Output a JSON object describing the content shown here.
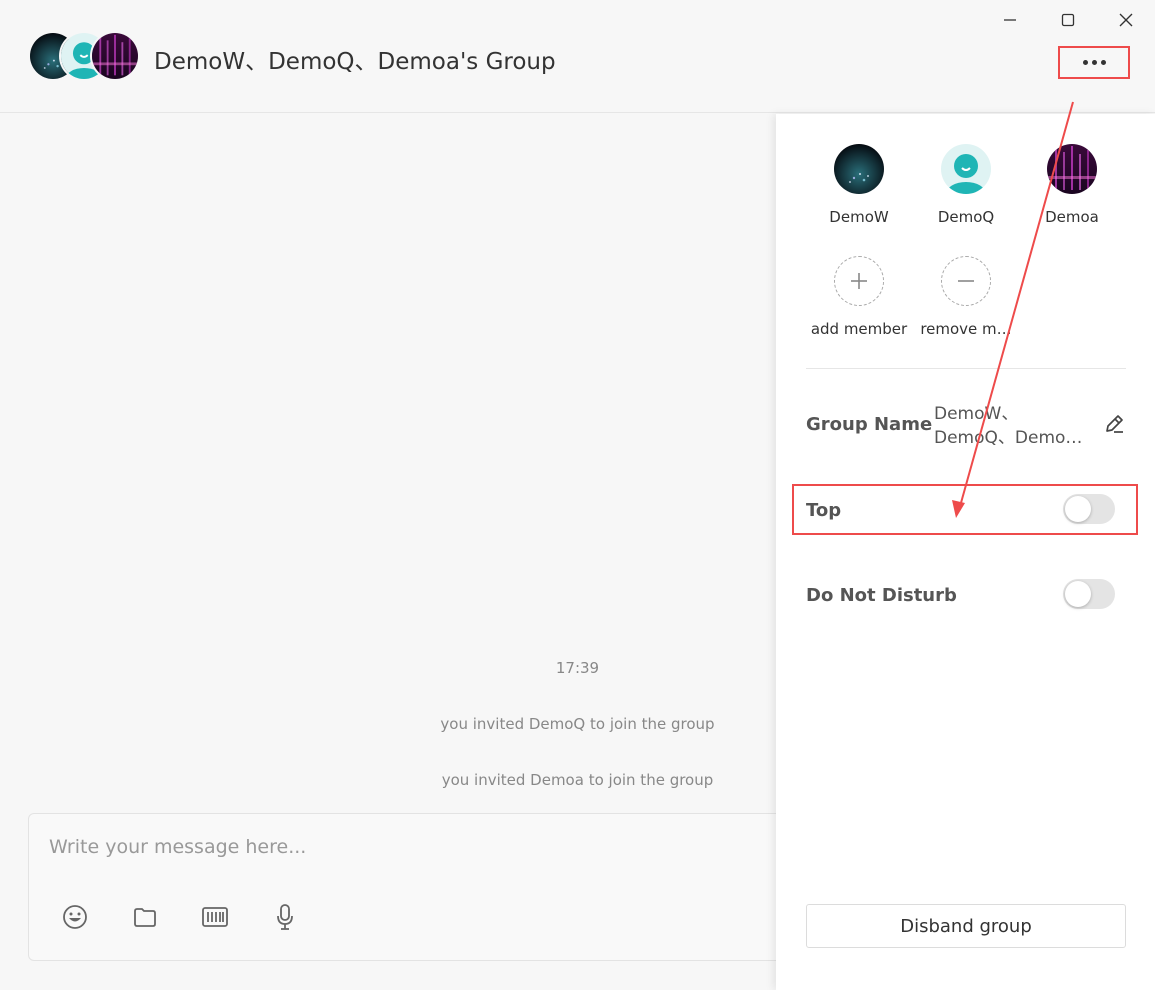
{
  "window": {
    "group_title": "DemoW、DemoQ、Demoa's Group"
  },
  "chat": {
    "time": "17:39",
    "messages": [
      "you invited DemoQ to join the group",
      "you invited Demoa to join the group"
    ]
  },
  "composer": {
    "placeholder": "Write your message here..."
  },
  "panel": {
    "members": [
      {
        "name": "DemoW"
      },
      {
        "name": "DemoQ"
      },
      {
        "name": "Demoa"
      }
    ],
    "add_member": "add member",
    "remove_member": "remove m…",
    "group_name_label": "Group Name",
    "group_name_line1": "DemoW、",
    "group_name_line2": "DemoQ、Demo…",
    "top_label": "Top",
    "top_enabled": false,
    "dnd_label": "Do Not Disturb",
    "dnd_enabled": false,
    "disband_label": "Disband group"
  },
  "colors": {
    "highlight": "#ee4b4b",
    "teal": "#1fb5b5"
  }
}
